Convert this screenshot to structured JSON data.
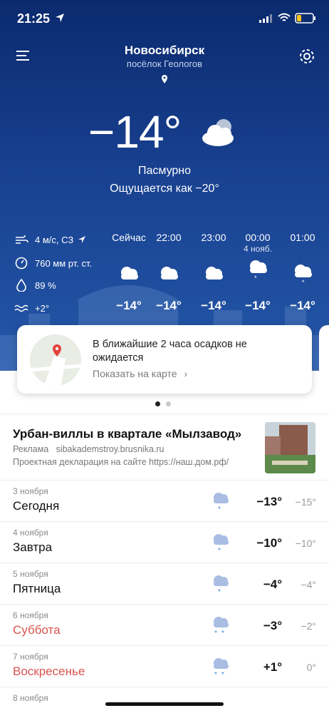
{
  "status": {
    "time": "21:25"
  },
  "header": {
    "city": "Новосибирск",
    "district": "посёлок Геологов"
  },
  "current": {
    "temp": "−14°",
    "condition": "Пасмурно",
    "feels": "Ощущается как −20°"
  },
  "stats": {
    "wind": "4 м/с, СЗ",
    "pressure": "760 мм рт. ст.",
    "humidity": "89 %",
    "water": "+2°"
  },
  "hourly": [
    {
      "time": "Сейчас",
      "date": "",
      "temp": "−14°",
      "icon": "cloud-icon"
    },
    {
      "time": "22:00",
      "date": "",
      "temp": "−14°",
      "icon": "cloud-icon"
    },
    {
      "time": "23:00",
      "date": "",
      "temp": "−14°",
      "icon": "cloud-icon"
    },
    {
      "time": "00:00",
      "date": "4 нояб.",
      "temp": "−14°",
      "icon": "cloud-snow-icon"
    },
    {
      "time": "01:00",
      "date": "",
      "temp": "−14°",
      "icon": "cloud-snow-icon"
    }
  ],
  "precip_card": {
    "text": "В ближайшие 2 часа осадков не ожидается",
    "link": "Показать на карте"
  },
  "ad": {
    "title": "Урбан-виллы в квартале «Мылзавод»",
    "label": "Реклама",
    "site": "sibakademstroy.brusnika.ru",
    "note": "Проектная декларация на сайте https://наш.дом.рф/"
  },
  "forecast": [
    {
      "date": "3 ноября",
      "name": "Сегодня",
      "hi": "−13°",
      "lo": "−15°",
      "weekend": false,
      "snow": 1
    },
    {
      "date": "4 ноября",
      "name": "Завтра",
      "hi": "−10°",
      "lo": "−10°",
      "weekend": false,
      "snow": 1
    },
    {
      "date": "5 ноября",
      "name": "Пятница",
      "hi": "−4°",
      "lo": "−4°",
      "weekend": false,
      "snow": 1
    },
    {
      "date": "6 ноября",
      "name": "Суббота",
      "hi": "−3°",
      "lo": "−2°",
      "weekend": true,
      "snow": 2
    },
    {
      "date": "7 ноября",
      "name": "Воскресенье",
      "hi": "+1°",
      "lo": "0°",
      "weekend": true,
      "snow": 2
    },
    {
      "date": "8 ноября",
      "name": "",
      "hi": "",
      "lo": "",
      "weekend": false,
      "snow": 1
    }
  ],
  "colors": {
    "sky_top": "#0b2a6e",
    "sky_bottom": "#2457a8",
    "weekend": "#d9534f"
  }
}
